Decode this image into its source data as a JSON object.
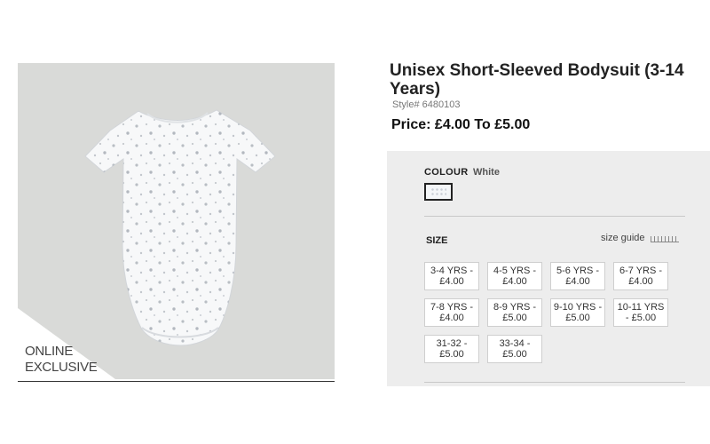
{
  "product": {
    "title": "Unisex Short-Sleeved Bodysuit (3-14 Years)",
    "style": "Style# 6480103",
    "price": "Price: £4.00 To £5.00",
    "badge_line1": "ONLINE",
    "badge_line2": "EXCLUSIVE"
  },
  "colour": {
    "label": "COLOUR",
    "value": "White",
    "swatch_color": "#f4f6f8"
  },
  "size": {
    "label": "SIZE",
    "guide": "size guide",
    "options": [
      {
        "range": "3-4 YRS -",
        "price": "£4.00"
      },
      {
        "range": "4-5 YRS -",
        "price": "£4.00"
      },
      {
        "range": "5-6 YRS -",
        "price": "£4.00"
      },
      {
        "range": "6-7 YRS -",
        "price": "£4.00"
      },
      {
        "range": "7-8 YRS -",
        "price": "£4.00"
      },
      {
        "range": "8-9 YRS -",
        "price": "£5.00"
      },
      {
        "range": "9-10 YRS -",
        "price": "£5.00"
      },
      {
        "range": "10-11 YRS",
        "price": "- £5.00"
      },
      {
        "range": "31-32 -",
        "price": "£5.00"
      },
      {
        "range": "33-34 -",
        "price": "£5.00"
      }
    ]
  },
  "colors": {
    "image_bg": "#d9dad8",
    "panel_bg": "#ededed"
  }
}
